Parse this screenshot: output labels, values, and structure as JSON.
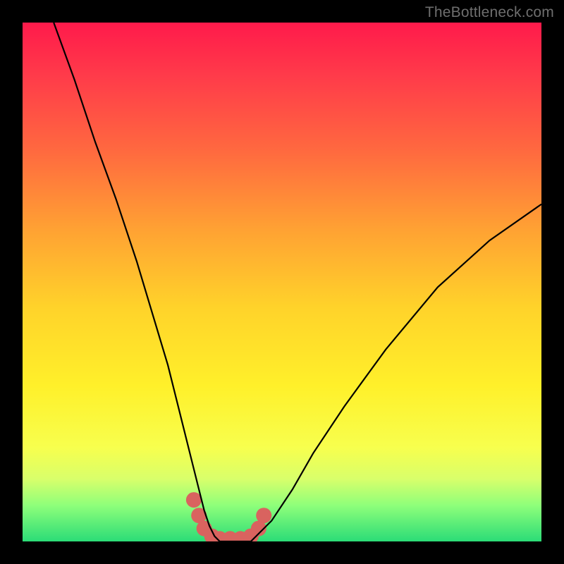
{
  "watermark": "TheBottleneck.com",
  "chart_data": {
    "type": "line",
    "title": "",
    "xlabel": "",
    "ylabel": "",
    "xlim": [
      0,
      100
    ],
    "ylim": [
      0,
      100
    ],
    "series": [
      {
        "name": "bottleneck-curve",
        "x": [
          6,
          10,
          14,
          18,
          22,
          25,
          28,
          30,
          32,
          34,
          35,
          36,
          37,
          38,
          40,
          42,
          44,
          45,
          48,
          52,
          56,
          62,
          70,
          80,
          90,
          100
        ],
        "y": [
          100,
          89,
          77,
          66,
          54,
          44,
          34,
          26,
          18,
          10,
          6,
          3,
          1,
          0,
          0,
          0,
          0,
          1,
          4,
          10,
          17,
          26,
          37,
          49,
          58,
          65
        ]
      },
      {
        "name": "highlight-dots",
        "x": [
          33,
          34,
          35,
          36.5,
          38,
          40,
          42,
          44,
          45.5,
          46.5
        ],
        "y": [
          8,
          5,
          2.5,
          1,
          0.5,
          0.5,
          0.5,
          1,
          2.5,
          5
        ]
      }
    ],
    "colors": {
      "curve": "#000000",
      "dots": "#d9635f",
      "gradient_top": "#ff1a4b",
      "gradient_mid": "#fff02a",
      "gradient_bottom": "#2bdc77"
    }
  }
}
